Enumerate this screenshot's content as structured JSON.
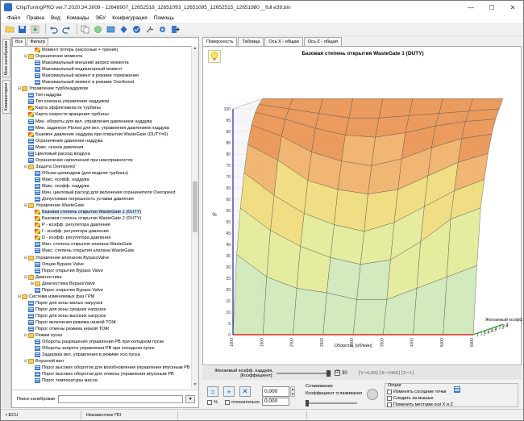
{
  "window": {
    "title": "ChipTuningPRO ver.7.2020.34.3009 - 12648907_12652518_12651093_12651095_12652515_12651980__full e39.bin",
    "controls": [
      "—",
      "☐",
      "✕"
    ]
  },
  "menu": [
    "Файл",
    "Правка",
    "Вид",
    "Команды",
    "ЭБУ",
    "Конфигурация",
    "Помощь"
  ],
  "left": {
    "vertical_tabs": [
      "Мою калибровки",
      "Комментарии"
    ],
    "tree_tabs": [
      "Все",
      "Фильтр"
    ],
    "tree": [
      {
        "indent": 3,
        "icon": "map",
        "label": "Момент потерь (насосные + трение)"
      },
      {
        "indent": 2,
        "icon": "folder",
        "exp": "-",
        "label": "Ограничение момента"
      },
      {
        "indent": 3,
        "icon": "table",
        "label": "Максимальный внешний запрос момента"
      },
      {
        "indent": 3,
        "icon": "table",
        "label": "Максимальный индикаторный момент"
      },
      {
        "indent": 3,
        "icon": "table",
        "label": "Максимальный момент в режиме торможения"
      },
      {
        "indent": 3,
        "icon": "table",
        "label": "Максимальный момент в режиме Overboost"
      },
      {
        "indent": 1,
        "icon": "folder",
        "exp": "-",
        "label": "Управление турбонаддувом"
      },
      {
        "indent": 2,
        "icon": "table",
        "label": "Тип наддува"
      },
      {
        "indent": 2,
        "icon": "table",
        "label": "Тип клапана управления наддувом"
      },
      {
        "indent": 2,
        "icon": "map",
        "label": "Карта эффективности турбины"
      },
      {
        "indent": 2,
        "icon": "map",
        "label": "Карта скорости вращения турбины"
      },
      {
        "indent": 2,
        "icon": "table",
        "label": "Мин. обороты для вкл. управления давлением наддува"
      },
      {
        "indent": 2,
        "icon": "table",
        "label": "Мин. заданное Pboost для вкл. управления давлением наддува"
      },
      {
        "indent": 2,
        "icon": "map",
        "label": "Базовое давление наддува при открытом WasteGate (DUTY=0)"
      },
      {
        "indent": 2,
        "icon": "table",
        "label": "Ограничение давления наддува"
      },
      {
        "indent": 2,
        "icon": "table",
        "label": "Макс. скачок давления"
      },
      {
        "indent": 2,
        "icon": "table",
        "label": "Цикловый расход воздуха"
      },
      {
        "indent": 2,
        "icon": "table",
        "label": "Ограничение наполнения при неисправностях"
      },
      {
        "indent": 2,
        "icon": "folder",
        "exp": "-",
        "label": "Защита Overspeed"
      },
      {
        "indent": 3,
        "icon": "table",
        "label": "Объем цилиндров (для модели турбины)"
      },
      {
        "indent": 3,
        "icon": "table",
        "label": "Макс. коэфф. наддува"
      },
      {
        "indent": 3,
        "icon": "table",
        "label": "Макс. коэфф. наддува"
      },
      {
        "indent": 3,
        "icon": "table",
        "label": "Мин. цикловый расход для включения ограничителя Overspeed"
      },
      {
        "indent": 3,
        "icon": "table",
        "label": "Допустимая погрешность уставки давления"
      },
      {
        "indent": 2,
        "icon": "folder",
        "exp": "-",
        "label": "Управление WasteGate"
      },
      {
        "indent": 3,
        "icon": "map",
        "label": "Базовая степень открытия WasteGate 1 (DUTY)",
        "selected": true
      },
      {
        "indent": 3,
        "icon": "map",
        "label": "Базовая степень открытия WasteGate 2 (DUTY)"
      },
      {
        "indent": 3,
        "icon": "map",
        "label": "P - коэфф. регулятора давления"
      },
      {
        "indent": 3,
        "icon": "map",
        "label": "I - коэфф. регулятора давления"
      },
      {
        "indent": 3,
        "icon": "map",
        "label": "D - коэфф. регулятора давления"
      },
      {
        "indent": 3,
        "icon": "table",
        "label": "Мин. степень открытия клапана WasteGate"
      },
      {
        "indent": 3,
        "icon": "table",
        "label": "Макс. степень открытия клапана WasteGate"
      },
      {
        "indent": 2,
        "icon": "folder",
        "exp": "-",
        "label": "Управление клапаном BypassValve"
      },
      {
        "indent": 3,
        "icon": "table",
        "label": "Опции Bypass Valve"
      },
      {
        "indent": 3,
        "icon": "table",
        "label": "Порог открытия Bypass Valve"
      },
      {
        "indent": 2,
        "icon": "folder",
        "exp": "-",
        "label": "Диагностика"
      },
      {
        "indent": 3,
        "icon": "folder",
        "exp": "+",
        "label": "Диагностика BypassValve"
      },
      {
        "indent": 3,
        "icon": "table",
        "label": "Порог открытия Bypass Valve"
      },
      {
        "indent": 1,
        "icon": "folder",
        "exp": "-",
        "label": "Система изменяемых фаз ГРМ"
      },
      {
        "indent": 2,
        "icon": "table",
        "label": "Порог для зоны малых нагрузок"
      },
      {
        "indent": 2,
        "icon": "table",
        "label": "Порог для зоны средних нагрузок"
      },
      {
        "indent": 2,
        "icon": "table",
        "label": "Порог для зоны высоких нагрузок"
      },
      {
        "indent": 2,
        "icon": "table",
        "label": "Порог включения режима низкой ТОЖ"
      },
      {
        "indent": 2,
        "icon": "table",
        "label": "Порог отмены режима низкой ТОЖ"
      },
      {
        "indent": 2,
        "icon": "folder",
        "exp": "-",
        "label": "Режим пуска"
      },
      {
        "indent": 3,
        "icon": "table",
        "label": "Обороты разрешения управления РВ при холодном пуске"
      },
      {
        "indent": 3,
        "icon": "table",
        "label": "Обороты запрета управления РВ при холодном пуске"
      },
      {
        "indent": 3,
        "icon": "table",
        "label": "Задержка вкл. управления в режиме хол.пуска"
      },
      {
        "indent": 2,
        "icon": "folder",
        "exp": "-",
        "label": "Впускной вал"
      },
      {
        "indent": 3,
        "icon": "table",
        "label": "Порог высоких оборотов для возобновления управления впускным РВ"
      },
      {
        "indent": 3,
        "icon": "table",
        "label": "Порог высоких оборотов для отмены управления впускным РВ"
      },
      {
        "indent": 3,
        "icon": "table",
        "label": "Порог температуры масла"
      }
    ],
    "search_label": "Поиск калибровки"
  },
  "right": {
    "tabs": [
      "Поверхность",
      "Таблица",
      "Ось X - общая",
      "Ось Z - общая"
    ],
    "param_label_1": "Желаемый коэфф. наддува,",
    "param_label_2": "[Коэффициент]:",
    "param_checked": "☑",
    "param_value": "30",
    "coords": "[V=0,00] [X=1000] [Z=1]",
    "edit_value": "0,000",
    "percent_label": "%",
    "relative_label": "относительно",
    "relative_value": "0,000",
    "smoothing_title": "Сглаживание",
    "smoothing_label": "Коэффициент сглаживания",
    "options_title": "Опции",
    "opt1": "Изменять соседние точки",
    "opt2": "Следить за мышью",
    "opt3": "Поменять местами оси X и Z"
  },
  "status": [
    "ECU",
    "Неизвестное ПО"
  ],
  "chart_data": {
    "type": "surface",
    "title": "Базовая степень открытия WasteGate 1 (DUTY)",
    "xlabel": "Обороты, [об/мин]",
    "ylabel": "%",
    "zlabel": "Желаемый коэфф. наддува",
    "x": [
      1000,
      1500,
      2000,
      2500,
      3000,
      3500,
      4000,
      5000,
      6000
    ],
    "z": [
      1,
      1.2,
      1.4,
      1.6,
      1.8,
      2,
      2.2,
      2.4,
      3
    ],
    "y_ticks": [
      0,
      5,
      10,
      15,
      20,
      25,
      30,
      35,
      40,
      45,
      50,
      55,
      60,
      65,
      70,
      75,
      80,
      85,
      90,
      95,
      100
    ],
    "ylim": [
      0,
      100
    ],
    "values": [
      [
        0,
        0,
        0,
        0,
        0,
        0,
        0,
        0,
        0
      ],
      [
        35,
        25,
        20,
        18,
        15,
        15,
        20,
        25,
        30
      ],
      [
        55,
        45,
        38,
        33,
        30,
        32,
        40,
        50,
        55
      ],
      [
        70,
        60,
        52,
        47,
        44,
        48,
        55,
        62,
        67
      ],
      [
        82,
        75,
        66,
        62,
        60,
        62,
        68,
        74,
        78
      ],
      [
        90,
        85,
        78,
        74,
        72,
        75,
        80,
        84,
        86
      ],
      [
        95,
        92,
        88,
        85,
        84,
        86,
        89,
        91,
        92
      ],
      [
        98,
        96,
        94,
        92,
        92,
        93,
        94,
        95,
        96
      ],
      [
        100,
        100,
        100,
        100,
        100,
        100,
        100,
        100,
        100
      ]
    ]
  }
}
